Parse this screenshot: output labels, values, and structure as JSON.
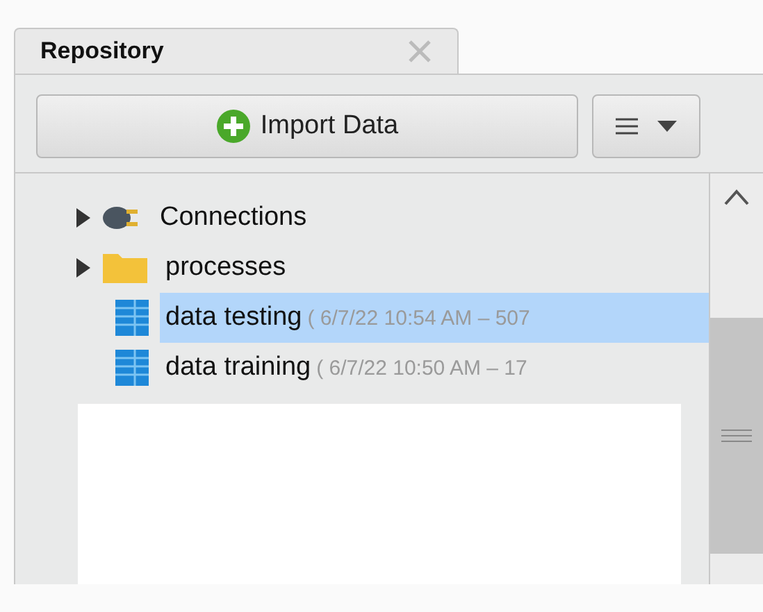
{
  "tab": {
    "label": "Repository"
  },
  "toolbar": {
    "import_button": "Import Data"
  },
  "tree": [
    {
      "label": "Connections",
      "kind": "connection",
      "expandable": true,
      "selected": false
    },
    {
      "label": "processes",
      "kind": "folder",
      "expandable": true,
      "selected": false
    },
    {
      "label": "data testing",
      "meta": "( 6/7/22 10:54 AM – 507",
      "kind": "data",
      "expandable": false,
      "selected": true
    },
    {
      "label": "data training",
      "meta": "( 6/7/22 10:50 AM – 17",
      "kind": "data",
      "expandable": false,
      "selected": false
    }
  ]
}
